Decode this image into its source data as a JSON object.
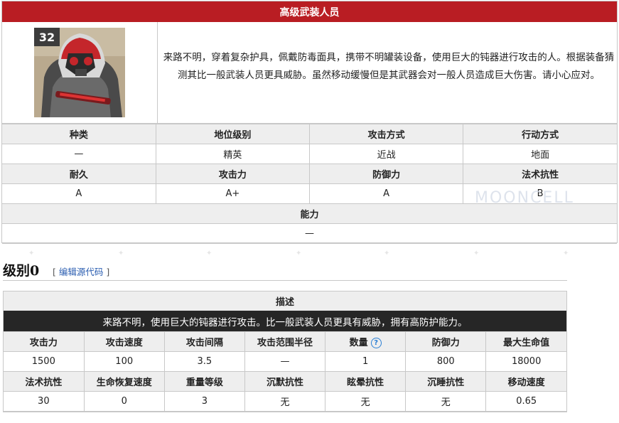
{
  "card": {
    "title": "高级武装人员",
    "level_badge": "32",
    "description": "来路不明，穿着复杂护具，佩戴防毒面具，携带不明罐装设备，使用巨大的钝器进行攻击的人。根据装备猜测其比一般武装人员更具威胁。虽然移动缓慢但是其武器会对一般人员造成巨大伤害。请小心应对。",
    "row1_headers": [
      "种类",
      "地位级别",
      "攻击方式",
      "行动方式"
    ],
    "row1_values": [
      "—",
      "精英",
      "近战",
      "地面"
    ],
    "row2_headers": [
      "耐久",
      "攻击力",
      "防御力",
      "法术抗性"
    ],
    "row2_values": [
      "A",
      "A+",
      "A",
      "B"
    ],
    "ability_header": "能力",
    "ability_value": "—"
  },
  "watermark": {
    "text": "MOONCELL"
  },
  "section": {
    "title": "级别0",
    "edit_open": "[",
    "edit_link": "编辑源代码",
    "edit_close": "]"
  },
  "stats": {
    "header": "描述",
    "description": "来路不明，使用巨大的钝器进行攻击。比一般武装人员更具有威胁，拥有高防护能力。",
    "row1_headers": [
      "攻击力",
      "攻击速度",
      "攻击间隔",
      "攻击范围半径",
      "数量",
      "防御力",
      "最大生命值"
    ],
    "row1_values": [
      "1500",
      "100",
      "3.5",
      "—",
      "1",
      "800",
      "18000"
    ],
    "row2_headers": [
      "法术抗性",
      "生命恢复速度",
      "重量等级",
      "沉默抗性",
      "眩晕抗性",
      "沉睡抗性",
      "移动速度"
    ],
    "row2_values": [
      "30",
      "0",
      "3",
      "无",
      "无",
      "无",
      "0.65"
    ],
    "help_icon": "question-circle-icon"
  },
  "colors": {
    "header_red": "#b91d23",
    "desc_bar": "#262626",
    "header_gray": "#eeeeee",
    "link_blue": "#2a5db0"
  }
}
